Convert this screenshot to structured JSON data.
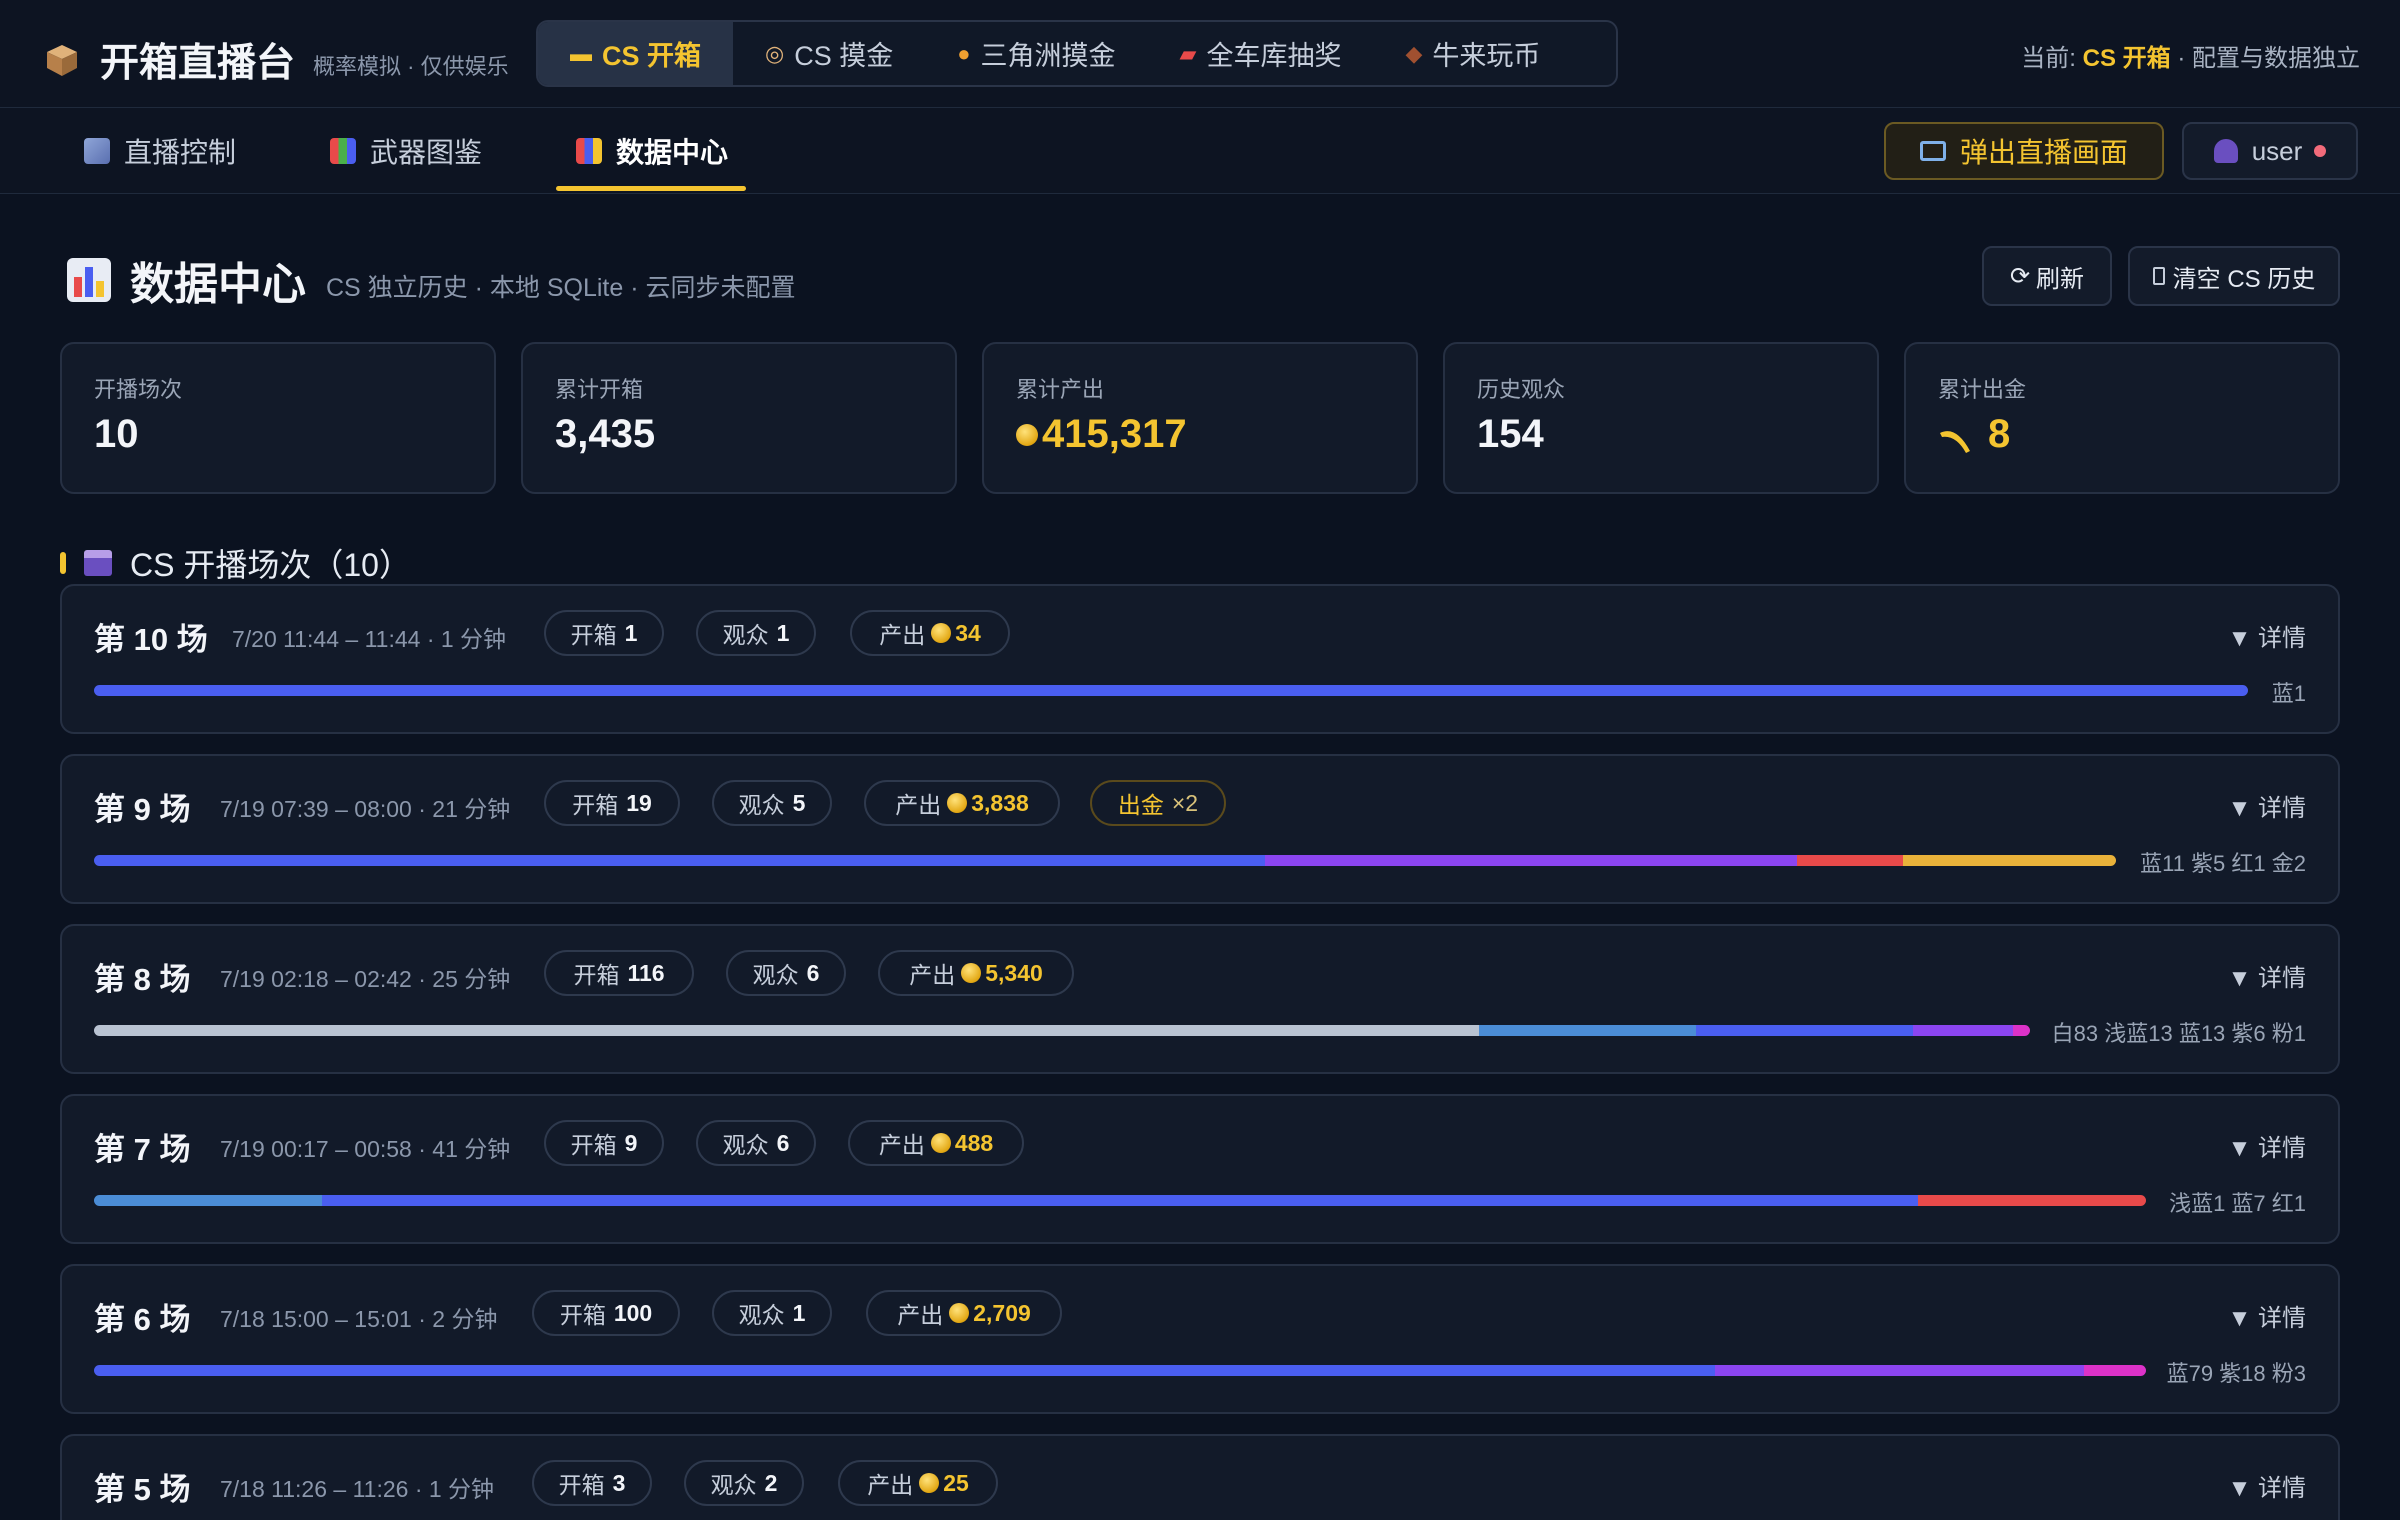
{
  "brand": {
    "title": "开箱直播台",
    "subtitle": "概率模拟 · 仅供娱乐"
  },
  "mode_tabs": [
    {
      "label": "CS 开箱",
      "icon": "gun-icon",
      "active": true
    },
    {
      "label": "CS 摸金",
      "icon": "compass-icon",
      "active": false
    },
    {
      "label": "三角洲摸金",
      "icon": "medal-icon",
      "active": false
    },
    {
      "label": "全车库抽奖",
      "icon": "car-icon",
      "active": false
    },
    {
      "label": "牛来玩币",
      "icon": "bull-icon",
      "active": false
    }
  ],
  "current": {
    "prefix": "当前:",
    "mode": "CS 开箱",
    "suffix": "· 配置与数据独立"
  },
  "subnav": {
    "items": [
      "直播控制",
      "武器图鉴",
      "数据中心"
    ],
    "active": "数据中心"
  },
  "popout_button": "弹出直播画面",
  "user": {
    "name": "user"
  },
  "page": {
    "title": "数据中心",
    "subtitle": "CS 独立历史 · 本地 SQLite · 云同步未配置",
    "refresh_label": "刷新",
    "clear_label": "清空 CS 历史"
  },
  "stats": [
    {
      "label": "开播场次",
      "value": "10"
    },
    {
      "label": "累计开箱",
      "value": "3,435"
    },
    {
      "label": "累计产出",
      "value": "415,317"
    },
    {
      "label": "历史观众",
      "value": "154"
    },
    {
      "label": "累计出金",
      "value": "8"
    }
  ],
  "section": {
    "title": "CS 开播场次（10）"
  },
  "labels": {
    "open": "开箱",
    "viewers": "观众",
    "output": "产出",
    "gold_out": "出金",
    "detail": "▼ 详情"
  },
  "colors": {
    "white": "#b9c3d2",
    "light_blue": "#4b8dd6",
    "blue": "#4a5ef0",
    "purple": "#8b45f0",
    "pink": "#dc32c8",
    "red": "#e84a4a",
    "gold": "#e9b23a"
  },
  "sessions": [
    {
      "title": "第 10 场",
      "time": "7/20 11:44 – 11:44 · 1 分钟",
      "open": "1",
      "viewers": "1",
      "output": "34",
      "gold_out": "",
      "rarity_text": "蓝1",
      "bar": [
        {
          "rarity": "blue",
          "count": 1
        }
      ]
    },
    {
      "title": "第 9 场",
      "time": "7/19 07:39 – 08:00 · 21 分钟",
      "open": "19",
      "viewers": "5",
      "output": "3,838",
      "gold_out": "×2",
      "rarity_text": "蓝11 紫5 红1 金2",
      "bar": [
        {
          "rarity": "blue",
          "count": 11
        },
        {
          "rarity": "purple",
          "count": 5
        },
        {
          "rarity": "red",
          "count": 1
        },
        {
          "rarity": "gold",
          "count": 2
        }
      ]
    },
    {
      "title": "第 8 场",
      "time": "7/19 02:18 – 02:42 · 25 分钟",
      "open": "116",
      "viewers": "6",
      "output": "5,340",
      "gold_out": "",
      "rarity_text": "白83 浅蓝13 蓝13 紫6 粉1",
      "bar": [
        {
          "rarity": "white",
          "count": 83
        },
        {
          "rarity": "light_blue",
          "count": 13
        },
        {
          "rarity": "blue",
          "count": 13
        },
        {
          "rarity": "purple",
          "count": 6
        },
        {
          "rarity": "pink",
          "count": 1
        }
      ]
    },
    {
      "title": "第 7 场",
      "time": "7/19 00:17 – 00:58 · 41 分钟",
      "open": "9",
      "viewers": "6",
      "output": "488",
      "gold_out": "",
      "rarity_text": "浅蓝1 蓝7 红1",
      "bar": [
        {
          "rarity": "light_blue",
          "count": 1
        },
        {
          "rarity": "blue",
          "count": 7
        },
        {
          "rarity": "red",
          "count": 1
        }
      ]
    },
    {
      "title": "第 6 场",
      "time": "7/18 15:00 – 15:01 · 2 分钟",
      "open": "100",
      "viewers": "1",
      "output": "2,709",
      "gold_out": "",
      "rarity_text": "蓝79 紫18 粉3",
      "bar": [
        {
          "rarity": "blue",
          "count": 79
        },
        {
          "rarity": "purple",
          "count": 18
        },
        {
          "rarity": "pink",
          "count": 3
        }
      ]
    },
    {
      "title": "第 5 场",
      "time": "7/18 11:26 – 11:26 · 1 分钟",
      "open": "3",
      "viewers": "2",
      "output": "25",
      "gold_out": "",
      "rarity_text": "",
      "bar": []
    }
  ]
}
